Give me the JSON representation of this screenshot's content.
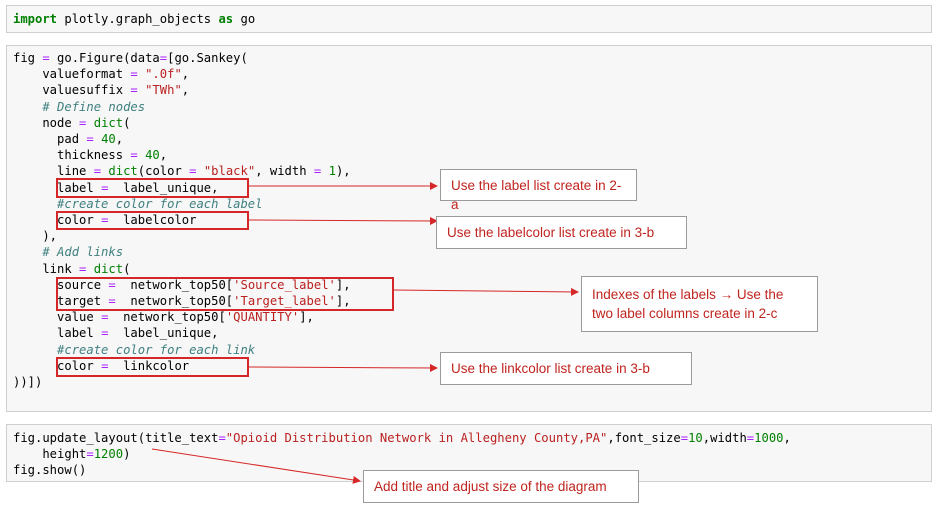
{
  "cell1": {
    "line1": [
      {
        "t": "import",
        "c": "kw"
      },
      {
        "t": " plotly.graph_objects ",
        "c": ""
      },
      {
        "t": "as",
        "c": "kw"
      },
      {
        "t": " go",
        "c": ""
      }
    ]
  },
  "cell2": {
    "lines": [
      [
        {
          "t": "fig ",
          "c": ""
        },
        {
          "t": "=",
          "c": "op"
        },
        {
          "t": " go.Figure(data",
          "c": ""
        },
        {
          "t": "=",
          "c": "op"
        },
        {
          "t": "[go.Sankey(",
          "c": ""
        }
      ],
      [
        {
          "t": "    valueformat ",
          "c": ""
        },
        {
          "t": "=",
          "c": "op"
        },
        {
          "t": " ",
          "c": ""
        },
        {
          "t": "\".0f\"",
          "c": "str"
        },
        {
          "t": ",",
          "c": ""
        }
      ],
      [
        {
          "t": "    valuesuffix ",
          "c": ""
        },
        {
          "t": "=",
          "c": "op"
        },
        {
          "t": " ",
          "c": ""
        },
        {
          "t": "\"TWh\"",
          "c": "str"
        },
        {
          "t": ",",
          "c": ""
        }
      ],
      [
        {
          "t": "    ",
          "c": ""
        },
        {
          "t": "# Define nodes",
          "c": "cm"
        }
      ],
      [
        {
          "t": "    node ",
          "c": ""
        },
        {
          "t": "=",
          "c": "op"
        },
        {
          "t": " ",
          "c": ""
        },
        {
          "t": "dict",
          "c": "num"
        },
        {
          "t": "(",
          "c": ""
        }
      ],
      [
        {
          "t": "      pad ",
          "c": ""
        },
        {
          "t": "=",
          "c": "op"
        },
        {
          "t": " ",
          "c": ""
        },
        {
          "t": "40",
          "c": "num"
        },
        {
          "t": ",",
          "c": ""
        }
      ],
      [
        {
          "t": "      thickness ",
          "c": ""
        },
        {
          "t": "=",
          "c": "op"
        },
        {
          "t": " ",
          "c": ""
        },
        {
          "t": "40",
          "c": "num"
        },
        {
          "t": ",",
          "c": ""
        }
      ],
      [
        {
          "t": "      line ",
          "c": ""
        },
        {
          "t": "=",
          "c": "op"
        },
        {
          "t": " ",
          "c": ""
        },
        {
          "t": "dict",
          "c": "num"
        },
        {
          "t": "(color ",
          "c": ""
        },
        {
          "t": "=",
          "c": "op"
        },
        {
          "t": " ",
          "c": ""
        },
        {
          "t": "\"black\"",
          "c": "str"
        },
        {
          "t": ", width ",
          "c": ""
        },
        {
          "t": "=",
          "c": "op"
        },
        {
          "t": " ",
          "c": ""
        },
        {
          "t": "1",
          "c": "num"
        },
        {
          "t": "),",
          "c": ""
        }
      ],
      [
        {
          "t": "      label ",
          "c": ""
        },
        {
          "t": "=",
          "c": "op"
        },
        {
          "t": "  label_unique,",
          "c": ""
        }
      ],
      [
        {
          "t": "      ",
          "c": ""
        },
        {
          "t": "#create color for each label",
          "c": "cm"
        }
      ],
      [
        {
          "t": "      color ",
          "c": ""
        },
        {
          "t": "=",
          "c": "op"
        },
        {
          "t": "  labelcolor",
          "c": ""
        }
      ],
      [
        {
          "t": "    ),",
          "c": ""
        }
      ],
      [
        {
          "t": "    ",
          "c": ""
        },
        {
          "t": "# Add links",
          "c": "cm"
        }
      ],
      [
        {
          "t": "    link ",
          "c": ""
        },
        {
          "t": "=",
          "c": "op"
        },
        {
          "t": " ",
          "c": ""
        },
        {
          "t": "dict",
          "c": "num"
        },
        {
          "t": "(",
          "c": ""
        }
      ],
      [
        {
          "t": "      source ",
          "c": ""
        },
        {
          "t": "=",
          "c": "op"
        },
        {
          "t": "  network_top50[",
          "c": ""
        },
        {
          "t": "'Source_label'",
          "c": "str"
        },
        {
          "t": "],",
          "c": ""
        }
      ],
      [
        {
          "t": "      target ",
          "c": ""
        },
        {
          "t": "=",
          "c": "op"
        },
        {
          "t": "  network_top50[",
          "c": ""
        },
        {
          "t": "'Target_label'",
          "c": "str"
        },
        {
          "t": "],",
          "c": ""
        }
      ],
      [
        {
          "t": "      value ",
          "c": ""
        },
        {
          "t": "=",
          "c": "op"
        },
        {
          "t": "  network_top50[",
          "c": ""
        },
        {
          "t": "'QUANTITY'",
          "c": "str"
        },
        {
          "t": "],",
          "c": ""
        }
      ],
      [
        {
          "t": "      label ",
          "c": ""
        },
        {
          "t": "=",
          "c": "op"
        },
        {
          "t": "  label_unique,",
          "c": ""
        }
      ],
      [
        {
          "t": "      ",
          "c": ""
        },
        {
          "t": "#create color for each link",
          "c": "cm"
        }
      ],
      [
        {
          "t": "      color ",
          "c": ""
        },
        {
          "t": "=",
          "c": "op"
        },
        {
          "t": "  linkcolor",
          "c": ""
        }
      ],
      [
        {
          "t": "))])",
          "c": ""
        }
      ]
    ]
  },
  "cell3": {
    "lines": [
      [
        {
          "t": "fig.update_layout(title_text",
          "c": ""
        },
        {
          "t": "=",
          "c": "op"
        },
        {
          "t": "\"Opioid Distribution Network in Allegheny County,PA\"",
          "c": "str"
        },
        {
          "t": ",font_size",
          "c": ""
        },
        {
          "t": "=",
          "c": "op"
        },
        {
          "t": "10",
          "c": "num"
        },
        {
          "t": ",width",
          "c": ""
        },
        {
          "t": "=",
          "c": "op"
        },
        {
          "t": "1000",
          "c": "num"
        },
        {
          "t": ",",
          "c": ""
        }
      ],
      [
        {
          "t": "    height",
          "c": ""
        },
        {
          "t": "=",
          "c": "op"
        },
        {
          "t": "1200",
          "c": "num"
        },
        {
          "t": ")",
          "c": ""
        }
      ],
      [
        {
          "t": "fig.show()",
          "c": ""
        }
      ]
    ]
  },
  "callouts": {
    "label_list": "Use the label list create in 2-a",
    "labelcolor_list": "Use the labelcolor list create in 3-b",
    "indexes_line1": "Indexes of the labels → Use the",
    "indexes_line2": "two label columns create in 2-c",
    "linkcolor_list": "Use the linkcolor list create in 3-b",
    "title_size": "Add title and adjust size of the diagram"
  },
  "colors": {
    "annotation_red": "#d62728",
    "callout_text": "#c0241f",
    "cell_background": "#f7f7f7"
  }
}
